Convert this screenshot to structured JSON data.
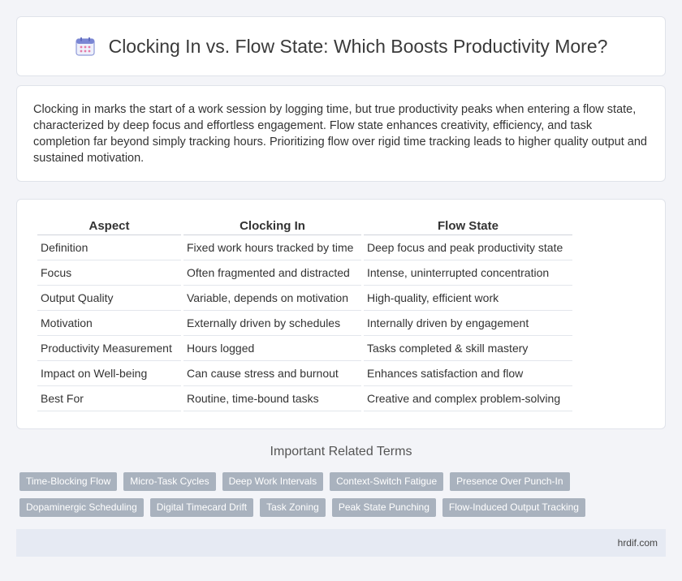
{
  "header": {
    "title": "Clocking In vs. Flow State: Which Boosts Productivity More?",
    "icon": "calendar-icon"
  },
  "summary": {
    "text": "Clocking in marks the start of a work session by logging time, but true productivity peaks when entering a flow state, characterized by deep focus and effortless engagement. Flow state enhances creativity, efficiency, and task completion far beyond simply tracking hours. Prioritizing flow over rigid time tracking leads to higher quality output and sustained motivation."
  },
  "table": {
    "headers": [
      "Aspect",
      "Clocking In",
      "Flow State"
    ],
    "rows": [
      [
        "Definition",
        "Fixed work hours tracked by time",
        "Deep focus and peak productivity state"
      ],
      [
        "Focus",
        "Often fragmented and distracted",
        "Intense, uninterrupted concentration"
      ],
      [
        "Output Quality",
        "Variable, depends on motivation",
        "High-quality, efficient work"
      ],
      [
        "Motivation",
        "Externally driven by schedules",
        "Internally driven by engagement"
      ],
      [
        "Productivity Measurement",
        "Hours logged",
        "Tasks completed & skill mastery"
      ],
      [
        "Impact on Well-being",
        "Can cause stress and burnout",
        "Enhances satisfaction and flow"
      ],
      [
        "Best For",
        "Routine, time-bound tasks",
        "Creative and complex problem-solving"
      ]
    ]
  },
  "related": {
    "title": "Important Related Terms",
    "row1": [
      "Time-Blocking Flow",
      "Micro-Task Cycles",
      "Deep Work Intervals",
      "Context-Switch Fatigue",
      "Presence Over Punch-In"
    ],
    "row2": [
      "Dopaminergic Scheduling",
      "Digital Timecard Drift",
      "Task Zoning",
      "Peak State Punching",
      "Flow-Induced Output Tracking"
    ]
  },
  "footer": {
    "site": "hrdif.com"
  },
  "colors": {
    "background": "#f3f4f8",
    "tag": "#a9b2be",
    "footer": "#e6eaf3"
  }
}
